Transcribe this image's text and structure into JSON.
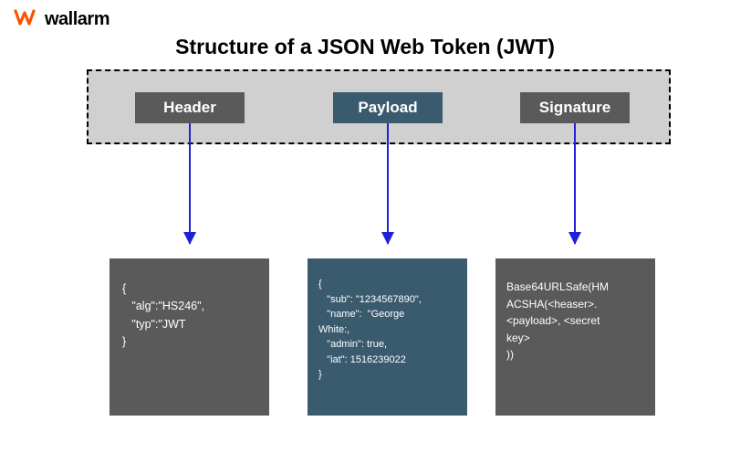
{
  "logo": {
    "text": "wallarm",
    "iconName": "wallarm-logo-icon"
  },
  "title": "Structure of a JSON Web Token (JWT)",
  "labels": {
    "header": "Header",
    "payload": "Payload",
    "signature": "Signature"
  },
  "codeBlocks": {
    "header": "{\n   \"alg\":\"HS246\",\n   \"typ\":\"JWT\n}",
    "payload": "{\n   \"sub\": \"1234567890\",\n   \"name\":  \"George\nWhite:,\n   \"admin\": true,\n   \"iat\": 1516239022\n}",
    "signature": "Base64URLSafe(HM\nACSHA(<heaser>.\n<payload>, <secret\nkey>\n))"
  },
  "colors": {
    "grayBox": "#5a5a5a",
    "blueBox": "#3a5a6e",
    "band": "#d0d0d0",
    "arrow": "#2020d8",
    "logoOrange": "#fc5200"
  }
}
